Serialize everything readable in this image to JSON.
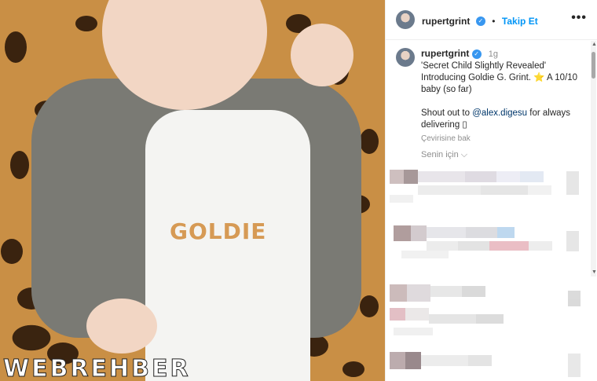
{
  "post": {
    "username": "rupertgrint",
    "follow_label": "Takip Et",
    "more_label": "•••",
    "photo_text": "GOLDIE",
    "watermark": "WEBREHBER"
  },
  "caption": {
    "username": "rupertgrint",
    "time": "1g",
    "line1": "'Secret Child Slightly Revealed'",
    "line2": "Introducing Goldie G. Grint. ⭐ A 10/10",
    "line3": "baby (so far)",
    "shout_prefix": "Shout out to ",
    "mention": "@alex.digesu",
    "shout_suffix": " for always delivering ▯",
    "translate": "Çevirisine bak",
    "for_you": "Senin için ⌵"
  },
  "icons": {
    "verified": "verified-badge-icon",
    "more": "more-options-icon",
    "chevron": "chevron-down-icon"
  },
  "colors": {
    "link": "#0095f6",
    "verified": "#3897f0",
    "muted": "#8e8e8e"
  }
}
